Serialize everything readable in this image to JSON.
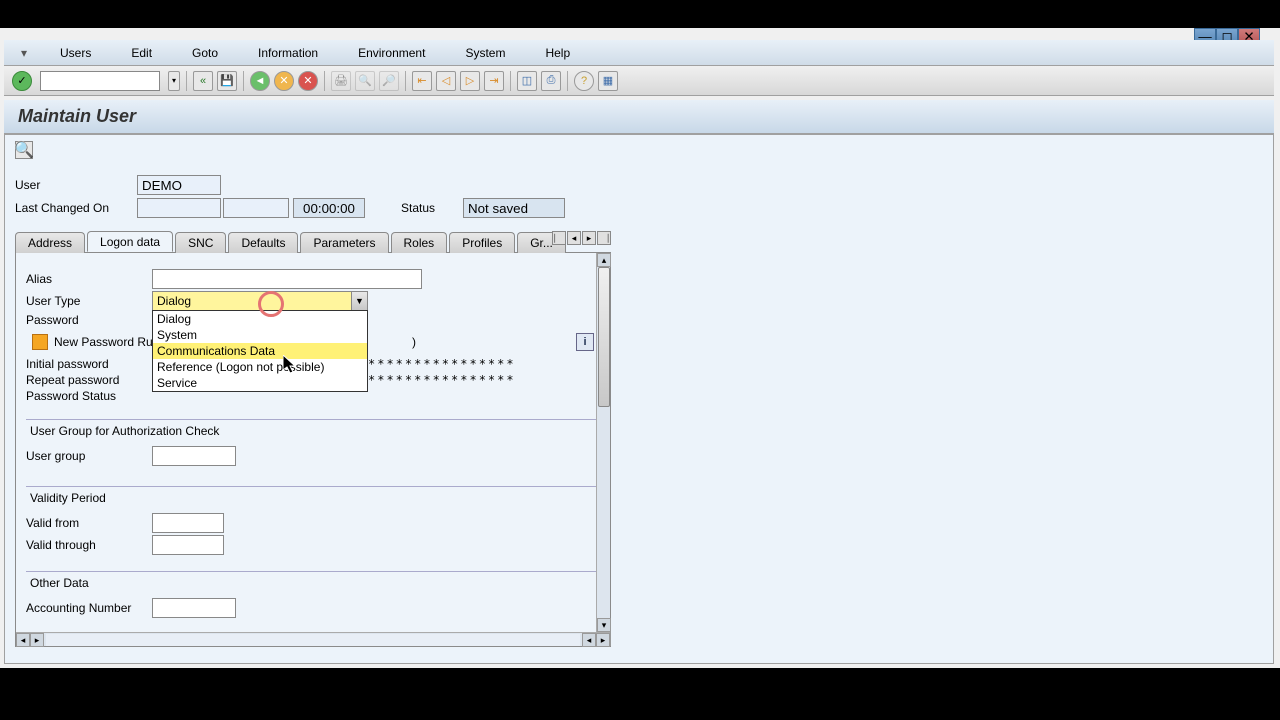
{
  "menu": {
    "items": [
      "Users",
      "Edit",
      "Goto",
      "Information",
      "Environment",
      "System",
      "Help"
    ]
  },
  "page_title": "Maintain User",
  "header": {
    "user_label": "User",
    "user_value": "DEMO",
    "last_changed_label": "Last Changed On",
    "time_value": "00:00:00",
    "status_label": "Status",
    "status_value": "Not saved"
  },
  "tabs": [
    "Address",
    "Logon data",
    "SNC",
    "Defaults",
    "Parameters",
    "Roles",
    "Profiles",
    "Gr..."
  ],
  "logon": {
    "alias_label": "Alias",
    "user_type_label": "User Type",
    "user_type_value": "Dialog",
    "user_type_options": [
      "Dialog",
      "System",
      "Communications Data",
      "Reference (Logon not possible)",
      "Service"
    ],
    "password_group": "Password",
    "pwd_rule": "New Password Rul",
    "initial_pwd_label": "Initial password",
    "repeat_pwd_label": "Repeat password",
    "pwd_mask": "****************",
    "pwd_status_label": "Password Status"
  },
  "usergroup": {
    "title": "User Group for Authorization Check",
    "label": "User group"
  },
  "validity": {
    "title": "Validity Period",
    "from_label": "Valid from",
    "through_label": "Valid through"
  },
  "other": {
    "title": "Other Data",
    "accounting_label": "Accounting Number"
  }
}
